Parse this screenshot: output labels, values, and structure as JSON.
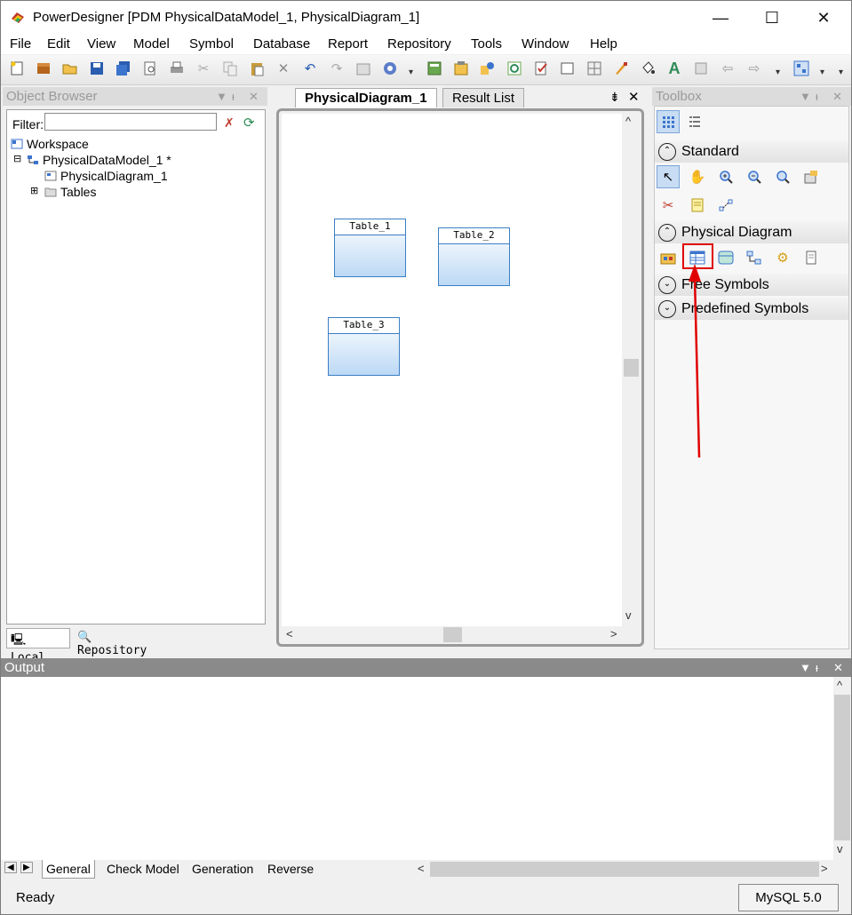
{
  "window": {
    "title": "PowerDesigner [PDM PhysicalDataModel_1, PhysicalDiagram_1]",
    "minimize": "—",
    "maximize": "☐",
    "close": "✕"
  },
  "menu": [
    "File",
    "Edit",
    "View",
    "Model",
    "Symbol",
    "Database",
    "Report",
    "Repository",
    "Tools",
    "Window",
    "Help"
  ],
  "object_browser": {
    "title": "Object Browser",
    "filter_label": "Filter:",
    "filter_value": "",
    "tree": {
      "workspace": "Workspace",
      "model": "PhysicalDataModel_1 *",
      "diagram": "PhysicalDiagram_1",
      "tables": "Tables"
    },
    "tabs": {
      "local": "Local",
      "repository": "Repository"
    }
  },
  "diagram": {
    "tabs": {
      "active": "PhysicalDiagram_1",
      "result": "Result List"
    },
    "tables": [
      "Table_1",
      "Table_2",
      "Table_3"
    ]
  },
  "toolbox": {
    "title": "Toolbox",
    "sections": {
      "standard": "Standard",
      "physical": "Physical Diagram",
      "free": "Free Symbols",
      "predefined": "Predefined Symbols"
    },
    "highlighted_tool": "table-tool",
    "highlight_color": "#e00000"
  },
  "output": {
    "title": "Output",
    "tabs": [
      "General",
      "Check Model",
      "Generation",
      "Reverse"
    ]
  },
  "status": {
    "text": "Ready",
    "dbms": "MySQL 5.0"
  },
  "colors": {
    "panel_header": "#8a8a8a",
    "table_border": "#3b7fc4",
    "annotation": "#e00000"
  }
}
